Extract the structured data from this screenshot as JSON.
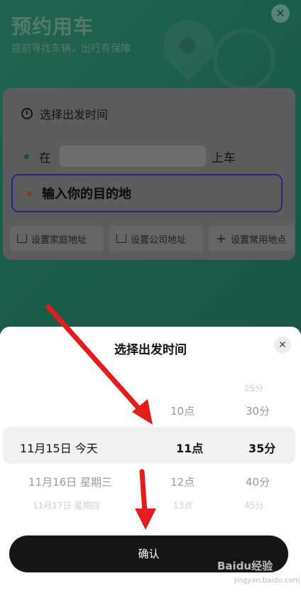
{
  "header": {
    "title": "预约用车",
    "subtitle": "提前寻找车辆，出行有保障",
    "close": "✕"
  },
  "form": {
    "time_label": "选择出发时间",
    "start_prefix": "在",
    "start_suffix": "上车",
    "destination_placeholder": "输入你的目的地",
    "quick_home": "设置家庭地址",
    "quick_company": "设置公司地址",
    "quick_common": "设置常用地点"
  },
  "sheet": {
    "title": "选择出发时间",
    "close": "✕",
    "date_column": {
      "selected": "11月15日  今天",
      "below": "11月16日  星期三",
      "below2": "11月17日  星期四"
    },
    "hour_column": {
      "above": "10点",
      "selected": "11点",
      "below": "12点",
      "below2": "13点"
    },
    "minute_column": {
      "above2": "25分",
      "above": "30分",
      "selected": "35分",
      "below": "40分",
      "below2": "45分"
    },
    "confirm_label": "确认"
  },
  "watermark": {
    "brand": "Baidu经验",
    "url": "jingyan.baidu.com"
  },
  "colors": {
    "header_green": "#2f9c7c",
    "arrow_red": "#e11d1d",
    "dest_border": "#3f47c7"
  }
}
